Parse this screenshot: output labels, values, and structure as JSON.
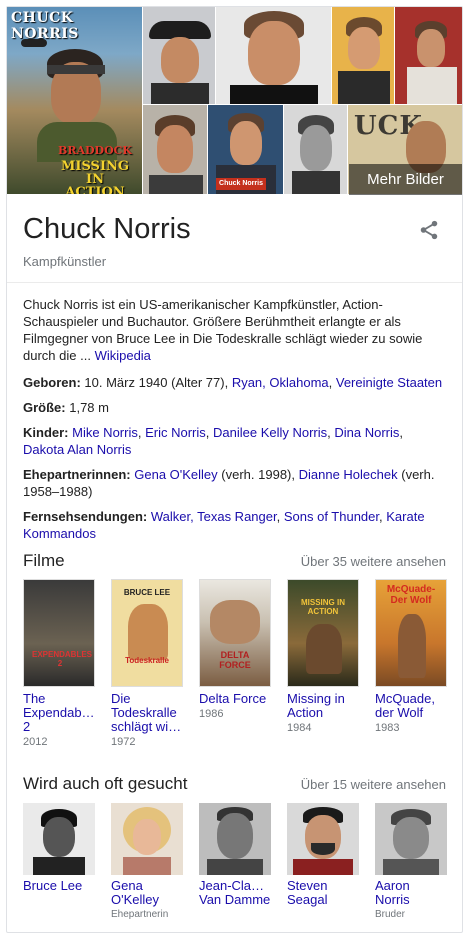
{
  "mosaic": {
    "poster_title": "CHUCK NORRIS",
    "poster_sub_a": "BRADDOCK",
    "poster_sub_b": "MISSING",
    "poster_sub_c": "IN ACTION III",
    "nameplate": "Chuck Norris",
    "more_images_label": "Mehr Bilder"
  },
  "header": {
    "title": "Chuck Norris",
    "subtitle": "Kampfkünstler",
    "share_icon": "share-icon"
  },
  "description": {
    "text": "Chuck Norris ist ein US-amerikanischer Kampfkünstler, Action-Schauspieler und Buchautor. Größere Berühmtheit erlangte er als Filmgegner von Bruce Lee in Die Todeskralle schlägt wieder zu sowie durch die ...",
    "source_link": "Wikipedia"
  },
  "facts": {
    "born": {
      "label": "Geboren:",
      "value": " 10. März 1940 (Alter 77), ",
      "link_place": "Ryan, Oklahoma",
      "sep": ", ",
      "link_country": "Vereinigte Staaten"
    },
    "height": {
      "label": "Größe:",
      "value": " 1,78 m"
    },
    "children": {
      "label": "Kinder:",
      "links": [
        "Mike Norris",
        "Eric Norris",
        "Danilee Kelly Norris",
        "Dina Norris",
        "Dakota Alan Norris"
      ]
    },
    "spouses": {
      "label": "Ehepartnerinnen:",
      "link1": "Gena O'Kelley",
      "text1": " (verh. 1998), ",
      "link2": "Dianne Holechek",
      "text2": " (verh. 1958–1988)"
    },
    "tv": {
      "label": "Fernsehsendungen:",
      "links": [
        "Walker, Texas Ranger",
        "Sons of Thunder",
        "Karate Kommandos"
      ]
    }
  },
  "films_section": {
    "title": "Filme",
    "more": "Über 35 weitere ansehen",
    "items": [
      {
        "title": "The Expendab… 2",
        "year": "2012"
      },
      {
        "title": "Die Todeskralle schlägt wi…",
        "year": "1972"
      },
      {
        "title": "Delta Force",
        "year": "1986"
      },
      {
        "title": "Missing in Action",
        "year": "1984"
      },
      {
        "title": "McQuade, der Wolf",
        "year": "1983"
      }
    ]
  },
  "related_section": {
    "title": "Wird auch oft gesucht",
    "more": "Über 15 weitere ansehen",
    "items": [
      {
        "name": "Bruce Lee",
        "relation": ""
      },
      {
        "name": "Gena O'Kelley",
        "relation": "Ehepartnerin"
      },
      {
        "name": "Jean-Cla… Van Damme",
        "relation": ""
      },
      {
        "name": "Steven Seagal",
        "relation": ""
      },
      {
        "name": "Aaron Norris",
        "relation": "Bruder"
      }
    ]
  },
  "poster_text": {
    "expendables": "EXPENDABLES 2",
    "bruce": "BRUCE LEE",
    "todes": "Todeskralle",
    "delta": "DELTA FORCE",
    "mia": "MISSING IN ACTION",
    "mcquade": "McQuade- Der Wolf"
  }
}
